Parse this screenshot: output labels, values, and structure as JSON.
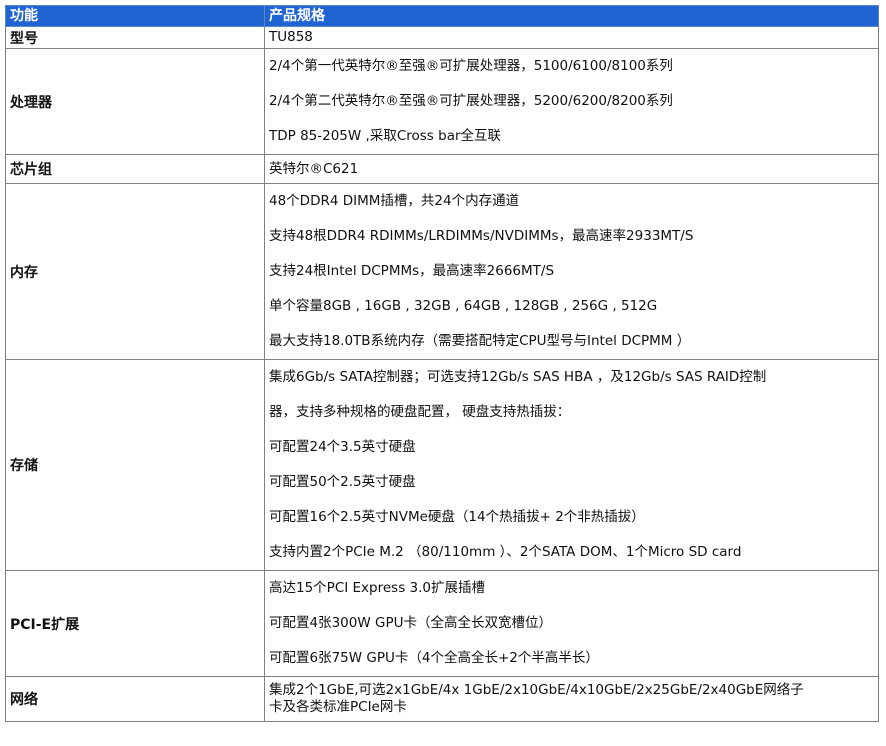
{
  "table": {
    "header": {
      "col1": "功能",
      "col2": "产品规格"
    },
    "rows": [
      {
        "feature": "型号",
        "lines": [
          "TU858"
        ]
      },
      {
        "feature": "处理器",
        "lines": [
          "2/4个第一代英特尔®至强®可扩展处理器，5100/6100/8100系列",
          "2/4个第二代英特尔®至强®可扩展处理器，5200/6200/8200系列",
          "TDP 85-205W ,采取Cross bar全互联"
        ]
      },
      {
        "feature": "芯片组",
        "lines": [
          "英特尔®C621"
        ]
      },
      {
        "feature": "内存",
        "lines": [
          "48个DDR4 DIMM插槽，共24个内存通道",
          "支持48根DDR4 RDIMMs/LRDIMMs/NVDIMMs，最高速率2933MT/S",
          "支持24根Intel DCPMMs，最高速率2666MT/S",
          "单个容量8GB , 16GB , 32GB , 64GB , 128GB , 256G , 512G",
          "最大支持18.0TB系统内存（需要搭配特定CPU型号与Intel DCPMM ）"
        ]
      },
      {
        "feature": "存储",
        "lines": [
          "集成6Gb/s SATA控制器；可选支持12Gb/s SAS HBA ，及12Gb/s SAS RAID控制",
          "器，支持多种规格的硬盘配置， 硬盘支持热插拔：",
          "可配置24个3.5英寸硬盘",
          "可配置50个2.5英寸硬盘",
          "可配置16个2.5英寸NVMe硬盘（14个热插拔+ 2个非热插拔）",
          "支持内置2个PCIe M.2 （80/110mm ）、2个SATA DOM、1个Micro SD card"
        ]
      },
      {
        "feature": "PCI-E扩展",
        "lines": [
          "高达15个PCI Express 3.0扩展插槽",
          "可配置4张300W GPU卡（全高全长双宽槽位）",
          "可配置6张75W GPU卡（4个全高全长+2个半高半长）"
        ]
      },
      {
        "feature": "网络",
        "lines": [
          "集成2个1GbE,可选2x1GbE/4x 1GbE/2x10GbE/4x10GbE/2x25GbE/2x40GbE网络子",
          "卡及各类标准PCIe网卡"
        ]
      }
    ]
  },
  "colors": {
    "header_bg": "#1f64d0",
    "header_text": "#ffffff",
    "border": "#808080"
  }
}
